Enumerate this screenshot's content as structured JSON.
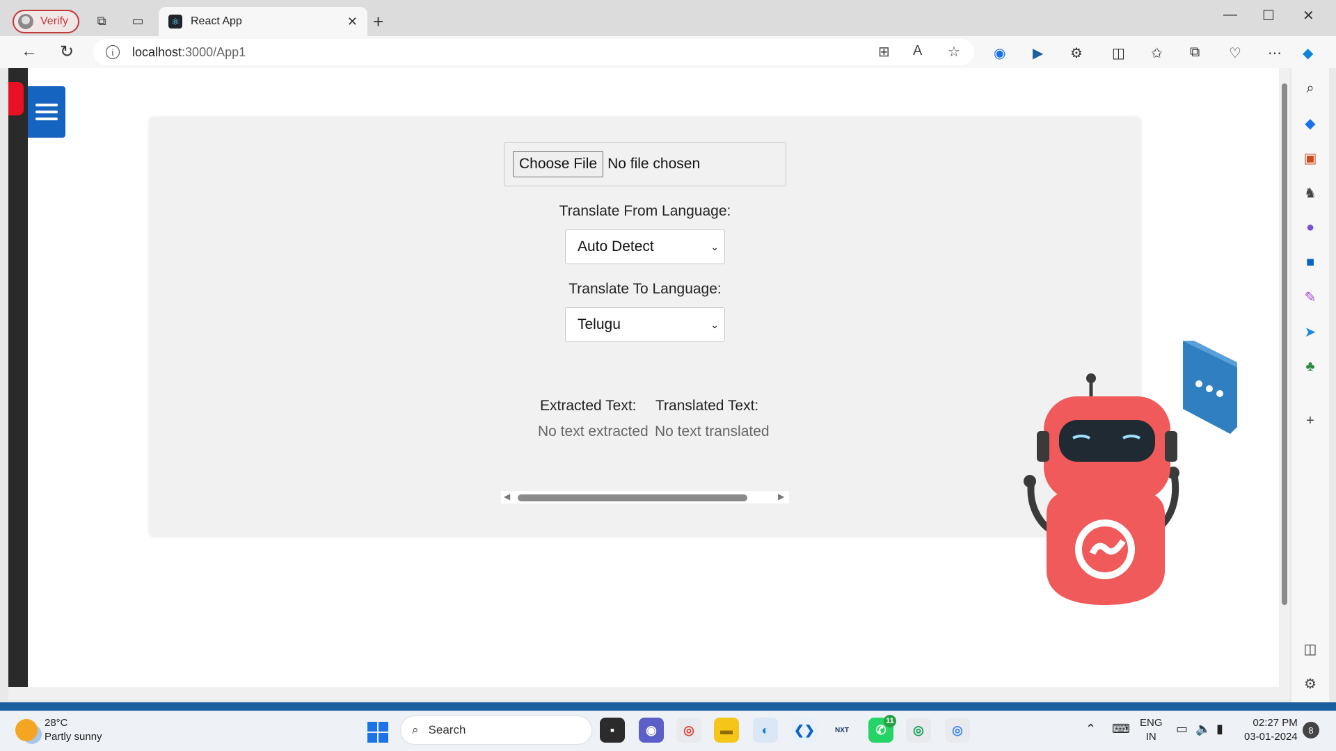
{
  "browser": {
    "profile_label": "Verify",
    "tab_title": "React App",
    "url_host": "localhost",
    "url_path": ":3000/App1"
  },
  "page": {
    "file_button": "Choose File",
    "file_status": "No file chosen",
    "from_label": "Translate From Language:",
    "from_value": "Auto Detect",
    "to_label": "Translate To Language:",
    "to_value": "Telugu",
    "extracted_label": "Extracted Text:",
    "extracted_value": "No text extracted",
    "translated_label": "Translated Text:",
    "translated_value": "No text translated"
  },
  "taskbar": {
    "temperature": "28°C",
    "weather": "Partly sunny",
    "search_label": "Search",
    "whatsapp_badge": "11",
    "lang_top": "ENG",
    "lang_bottom": "IN",
    "time": "02:27 PM",
    "date": "03-01-2024",
    "notifications": "8"
  },
  "colors": {
    "menu_button": "#1565c0",
    "profile_accent": "#c0393b",
    "robot_red": "#f05a5b",
    "robot_bubble": "#2f7fc1"
  }
}
